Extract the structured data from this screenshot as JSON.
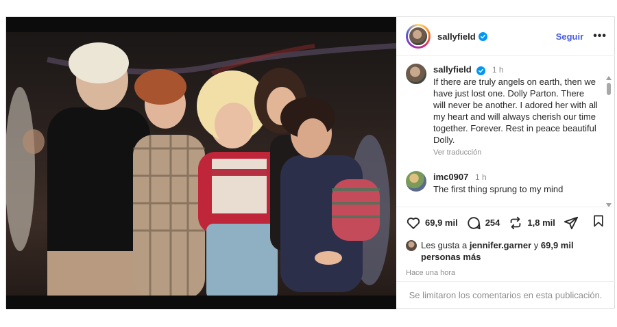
{
  "post": {
    "username": "sallyfield",
    "follow_label": "Seguir",
    "more_label": "•••"
  },
  "caption": {
    "username": "sallyfield",
    "time": "1 h",
    "text": "If there are truly angels on earth, then we have just lost one. Dolly Parton. There will never be another. I adored her with all my heart and will always cherish our time together. Forever. Rest in peace beautiful Dolly.",
    "translate_label": "Ver traducción"
  },
  "comments": [
    {
      "username": "imc0907",
      "time": "1 h",
      "text": "The first thing sprung to my mind"
    }
  ],
  "actions": {
    "likes": "69,9 mil",
    "comments": "254",
    "reposts": "1,8 mil"
  },
  "liked_by": {
    "prefix": "Les gusta a ",
    "user": "jennifer.garner",
    "middle": " y ",
    "count": "69,9 mil",
    "suffix": "personas más"
  },
  "posted_ago": "Hace una hora",
  "comments_closed": "Se limitaron los comentarios en esta publicación.",
  "colors": {
    "follow": "#4a5dde",
    "verified": "#0095f6",
    "muted": "#8e8e8e"
  }
}
